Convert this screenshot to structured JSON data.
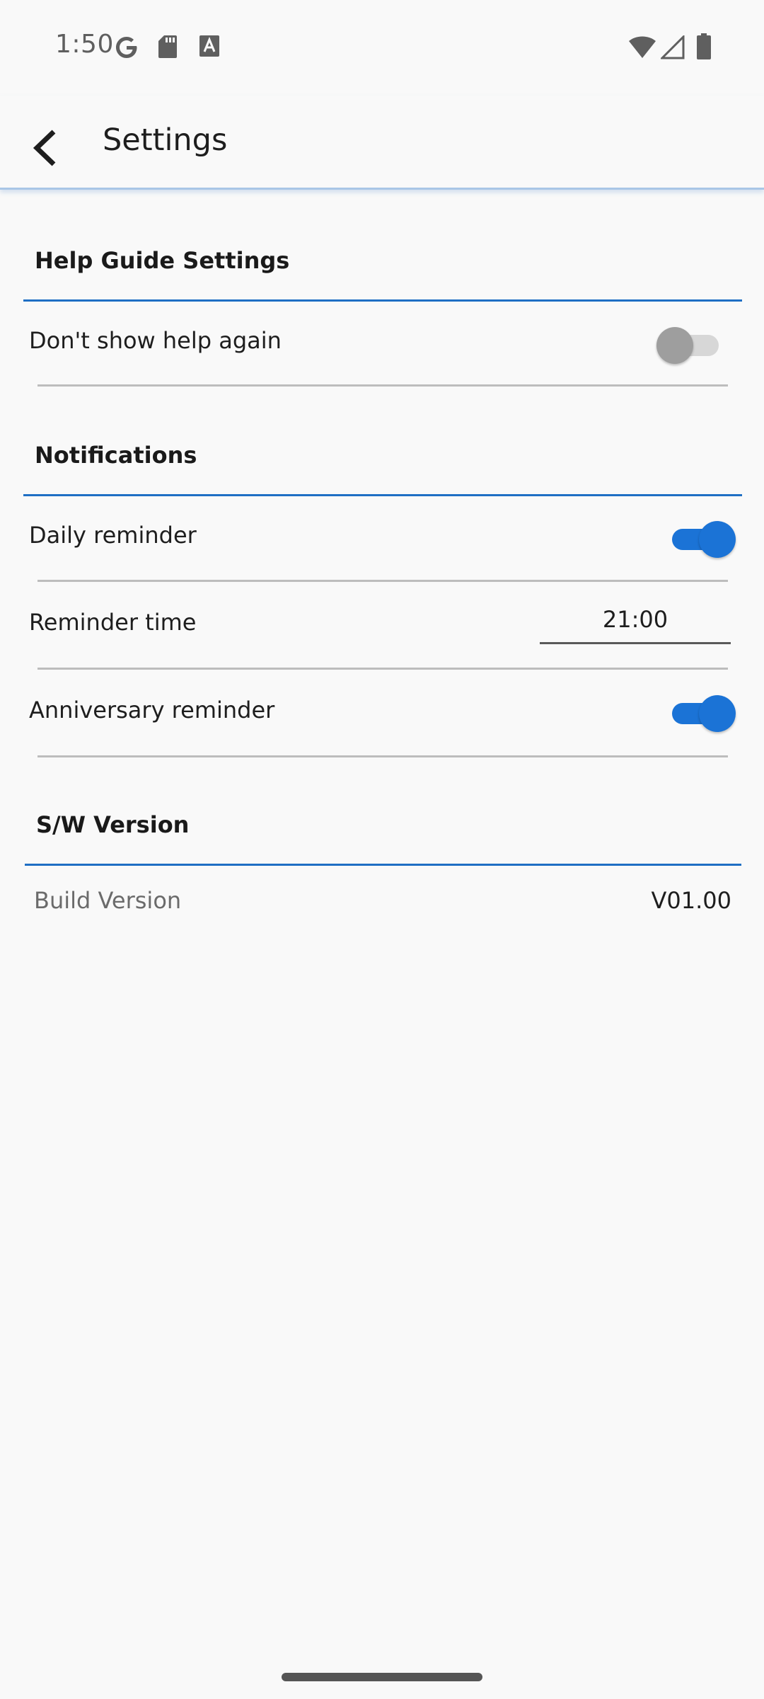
{
  "status_bar": {
    "time": "1:50",
    "left_icons": [
      "google-icon",
      "sd-card-icon",
      "font-a-icon"
    ],
    "right_icons": [
      "wifi-icon",
      "signal-icon",
      "battery-icon"
    ]
  },
  "app_bar": {
    "title": "Settings",
    "back_icon": "chevron-left-icon"
  },
  "sections": {
    "help": {
      "title": "Help Guide Settings",
      "dont_show_help": {
        "label": "Don't show help again",
        "enabled": false
      }
    },
    "notifications": {
      "title": "Notifications",
      "daily_reminder": {
        "label": "Daily reminder",
        "enabled": true
      },
      "reminder_time": {
        "label": "Reminder time",
        "value": "21:00"
      },
      "anniversary_reminder": {
        "label": "Anniversary reminder",
        "enabled": true
      }
    },
    "version": {
      "title": "S/W Version",
      "build": {
        "label": "Build Version",
        "value": "V01.00"
      }
    }
  },
  "colors": {
    "accent": "#1b73d6",
    "section_rule": "#1f6fc4",
    "toggle_off": "#9e9e9e",
    "background": "#f9f9f9"
  }
}
